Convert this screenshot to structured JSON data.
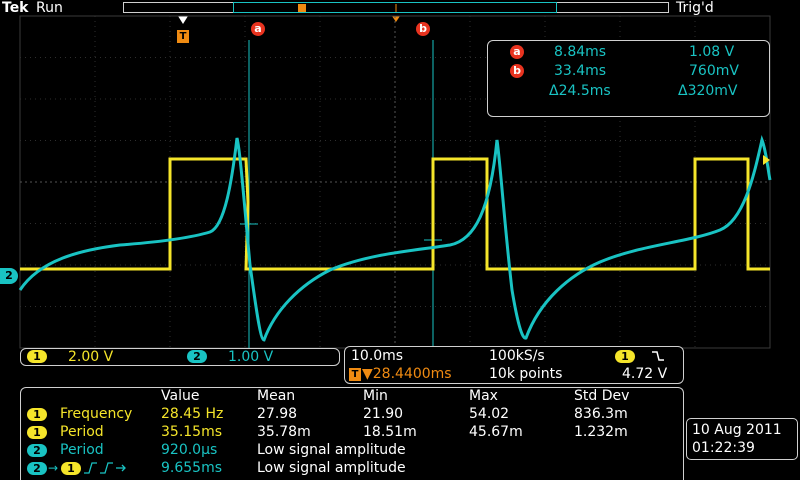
{
  "header": {
    "brand": "Tek",
    "run_state": "Run",
    "trigger_state": "Trig'd",
    "trigger_marker_label": "T"
  },
  "cursors": {
    "a": {
      "label": "a",
      "time": "8.84ms",
      "value": "1.08 V"
    },
    "b": {
      "label": "b",
      "time": "33.4ms",
      "value": "760mV"
    },
    "delta_time": "Δ24.5ms",
    "delta_value": "Δ320mV"
  },
  "channels": [
    {
      "id": "1",
      "scale": "2.00 V",
      "color": "#f5e52a"
    },
    {
      "id": "2",
      "scale": "1.00 V",
      "color": "#19c3c3"
    }
  ],
  "ground_marker": "2",
  "horizontal": {
    "time_div": "10.0ms",
    "sample_rate": "100kS/s",
    "trigger_position": "▼28.4400ms",
    "record_length": "10k points",
    "trigger_source": "1",
    "trigger_slope_icon": "falling-edge-icon",
    "trigger_level": "4.72 V"
  },
  "measurements": {
    "headers": [
      "Value",
      "Mean",
      "Min",
      "Max",
      "Std Dev"
    ],
    "rows": [
      {
        "source": "1",
        "source_color": "yellow",
        "name": "Frequency",
        "value": "28.45 Hz",
        "mean": "27.98",
        "min": "21.90",
        "max": "54.02",
        "std": "836.3m"
      },
      {
        "source": "1",
        "source_color": "yellow",
        "name": "Period",
        "value": "35.15ms",
        "mean": "35.78m",
        "min": "18.51m",
        "max": "45.67m",
        "std": "1.232m"
      },
      {
        "source": "2",
        "source_color": "cyan",
        "name": "Period",
        "value": "920.0µs",
        "note": "Low signal amplitude"
      },
      {
        "source": "2",
        "source_color": "cyan",
        "source2": "1",
        "name": "",
        "value": "9.655ms",
        "note": "Low signal amplitude"
      }
    ]
  },
  "datetime": {
    "date": "10 Aug 2011",
    "time": "01:22:39"
  }
}
